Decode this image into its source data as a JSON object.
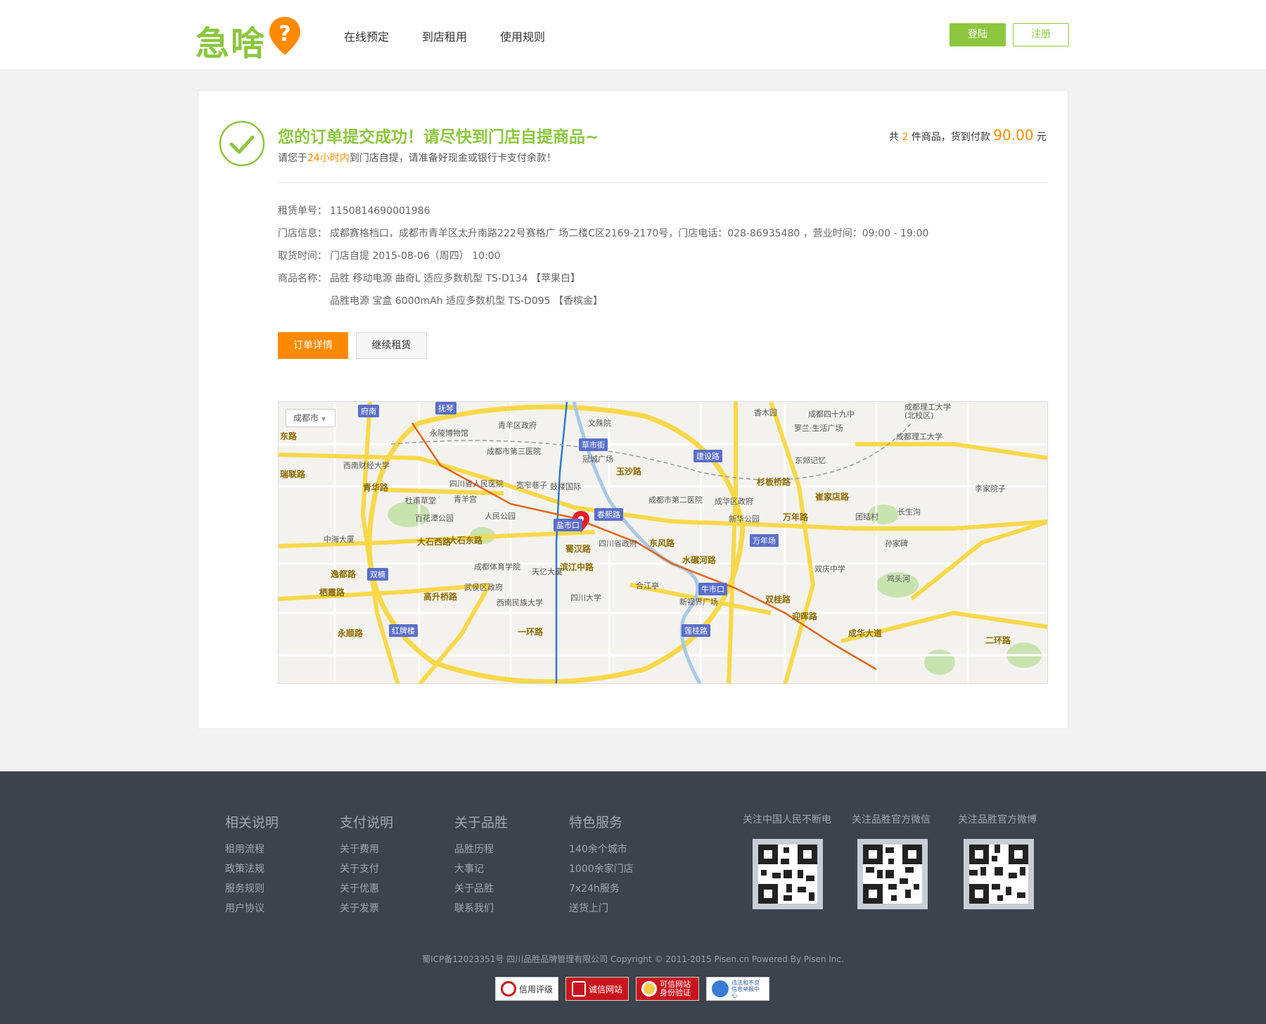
{
  "header": {
    "logo_text": "急啥",
    "nav": [
      "在线预定",
      "到店租用",
      "使用规则"
    ],
    "login_label": "登陆",
    "register_label": "注册"
  },
  "success": {
    "title": "您的订单提交成功！请尽快到门店自提商品~",
    "sub_prefix": "请您于",
    "sub_highlight": "24小时内",
    "sub_suffix": "到门店自提，请准备好现金或银行卡支付余款！"
  },
  "summary": {
    "prefix": "共",
    "count": "2",
    "middle": "件商品，货到付款",
    "amount": "90.00",
    "unit": "元"
  },
  "order": {
    "no_label": "租赁单号：",
    "no_value": "1150814690001986",
    "store_label": "门店信息：",
    "store_value": "成都赛格档口，成都市青羊区太升南路222号赛格广 场二楼C区2169-2170号，门店电话：028-86935480 ，营业时间：09:00 - 19:00",
    "pickup_label": "取货时间：",
    "pickup_value": "门店自提 2015-08-06（周四） 10:00",
    "product_label": "商品名称：",
    "product_1": "品胜 移动电源 曲奇L 适应多数机型 TS-D134 【苹果白】",
    "product_2": "品胜电源 宝盒 6000mAh 适应多数机型 TS-D095 【香槟金】"
  },
  "actions": {
    "detail_label": "订单详情",
    "continue_label": "继续租赁"
  },
  "map": {
    "city_select": "成都市",
    "places": [
      "府南",
      "抚琴",
      "青羊区政府",
      "文殊院",
      "永陵博物馆",
      "成都市第三医院",
      "草市街",
      "冠城广场",
      "西南财经大学",
      "四川省人民医院",
      "宽窄巷子",
      "鼓楼国际",
      "杜甫草堂",
      "青羊宫",
      "成都市第二医院",
      "成华区政府",
      "人民公园",
      "盐市口",
      "春熙路",
      "百花潭公园",
      "中海大厦",
      "四川省政府",
      "成都体育学院",
      "天亿大厦",
      "武侯区政府",
      "西南民族大学",
      "四川大学",
      "合江亭",
      "新视界广场",
      "牛市口",
      "红牌楼",
      "双楠",
      "建设路",
      "东郊记忆",
      "新华公园",
      "万年场",
      "双庆中学",
      "香木园",
      "成都四十九中",
      "罗兰·生活广场",
      "成都理工大学(北校区)",
      "成都理工大学",
      "李家院子",
      "团结村",
      "长生沟",
      "孙家碑",
      "鸡头河",
      "莲桂路"
    ],
    "roads": [
      "东路",
      "瑞联路",
      "青华路",
      "大石西路",
      "大石东路",
      "逸都路",
      "栖霞路",
      "永顺路",
      "高升桥路",
      "玉沙路",
      "蜀汉路",
      "滨江中路",
      "东风路",
      "水碾河路",
      "双桂路",
      "迎晖路",
      "成华大道",
      "万年路",
      "崔家店路",
      "杉板桥路",
      "一环路",
      "二环路"
    ]
  },
  "footer": {
    "columns": [
      {
        "title": "相关说明",
        "links": [
          "租用流程",
          "政策法规",
          "服务规则",
          "用户协议"
        ]
      },
      {
        "title": "支付说明",
        "links": [
          "关于费用",
          "关于支付",
          "关于优惠",
          "关于发票"
        ]
      },
      {
        "title": "关于品胜",
        "links": [
          "品胜历程",
          "大事记",
          "关于品胜",
          "联系我们"
        ]
      },
      {
        "title": "特色服务",
        "links": [
          "140余个城市",
          "1000余家门店",
          "7x24h服务",
          "送货上门"
        ]
      }
    ],
    "qr": [
      "关注中国人民不断电",
      "关注品胜官方微信",
      "关注品胜官方微博"
    ],
    "copyright": "蜀ICP备12023351号 四川品胜品牌管理有限公司 Copyright © 2011-2015 Pisen.cn Powered By Pisen Inc.",
    "badges": [
      "信用评级",
      "诚信网站",
      "可信网站身份验证",
      "违法和不良信息举报中心"
    ]
  },
  "colors": {
    "brand_green": "#8cc63f",
    "accent_orange": "#ff8a00",
    "footer_bg": "#3d434c"
  }
}
